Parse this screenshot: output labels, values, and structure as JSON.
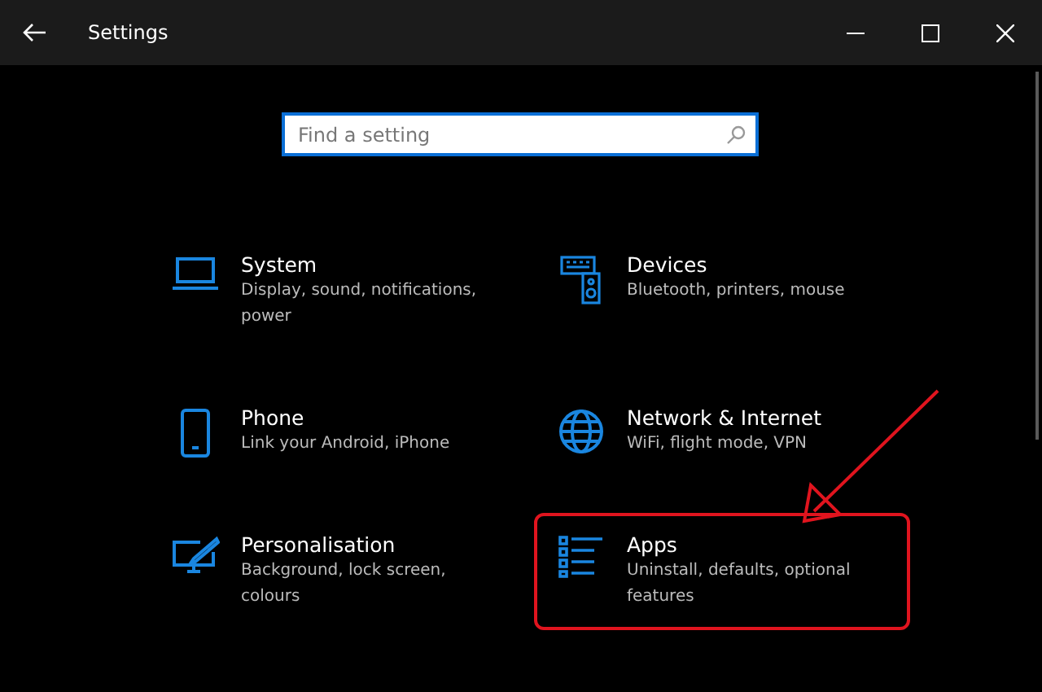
{
  "window": {
    "title": "Settings"
  },
  "search": {
    "placeholder": "Find a setting"
  },
  "categories": [
    {
      "kind": "laptop",
      "title": "System",
      "description": "Display, sound, notifications, power",
      "highlighted": false
    },
    {
      "kind": "devices",
      "title": "Devices",
      "description": "Bluetooth, printers, mouse",
      "highlighted": false
    },
    {
      "kind": "phone",
      "title": "Phone",
      "description": "Link your Android, iPhone",
      "highlighted": false
    },
    {
      "kind": "globe",
      "title": "Network & Internet",
      "description": "WiFi, flight mode, VPN",
      "highlighted": false
    },
    {
      "kind": "paint",
      "title": "Personalisation",
      "description": "Background, lock screen, colours",
      "highlighted": false
    },
    {
      "kind": "apps",
      "title": "Apps",
      "description": "Uninstall, defaults, optional features",
      "highlighted": true
    }
  ]
}
